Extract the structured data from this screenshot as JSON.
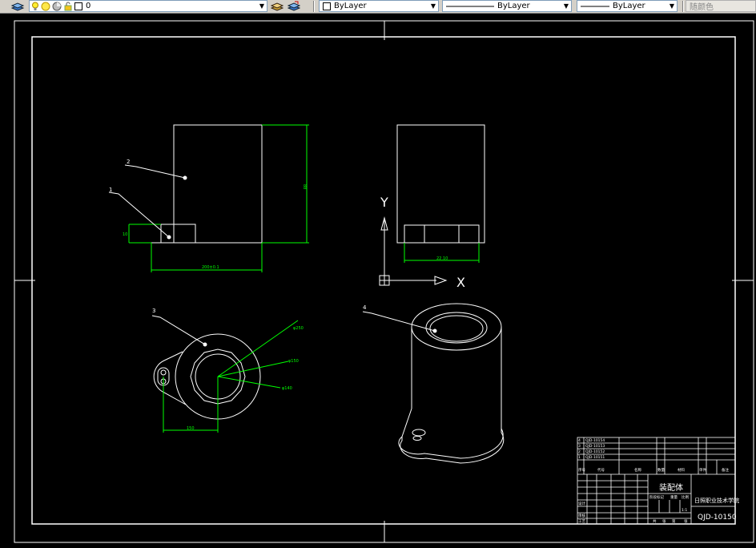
{
  "toolbar": {
    "layer_value": "0",
    "color_value": "ByLayer",
    "linetype_value": "ByLayer",
    "lineweight_value": "ByLayer",
    "plotstyle_value": "随颜色",
    "icons": [
      "layer-manager-icon",
      "bulb-icon",
      "sun-icon",
      "layer-color-icon",
      "lock-icon",
      "layer-state-icon",
      "layer-previous-icon"
    ]
  },
  "drawing": {
    "balloons": [
      "1",
      "2",
      "3",
      "4"
    ],
    "dimensions": {
      "front_height": "88",
      "front_width": "200±0.1",
      "base_height": "10",
      "side_width": "22.10",
      "top_dia_outer": "φ250",
      "top_dia_mid": "φ150",
      "top_dia_inner": "φ140",
      "top_offset": "150"
    },
    "ucs": {
      "x": "X",
      "y": "Y"
    },
    "title_block": {
      "part_name": "装配体",
      "company": "日照职业技术学院",
      "drawing_no": "QJD-10150",
      "bom_rows": [
        {
          "no": "4",
          "code": "QJD-10154"
        },
        {
          "no": "3",
          "code": "QJD-10153"
        },
        {
          "no": "2",
          "code": "QJD-10152"
        },
        {
          "no": "1",
          "code": "QJD-10151"
        }
      ],
      "header": [
        "序号",
        "代号",
        "名称",
        "数量",
        "材料",
        "单件",
        "备注"
      ],
      "sign_labels": [
        "设计",
        "审核",
        "工艺"
      ],
      "scale_labels": [
        "阶段标记",
        "重量",
        "比例"
      ],
      "sheet_labels": [
        "共",
        "张",
        "第",
        "张"
      ],
      "scale": "1:1"
    }
  }
}
